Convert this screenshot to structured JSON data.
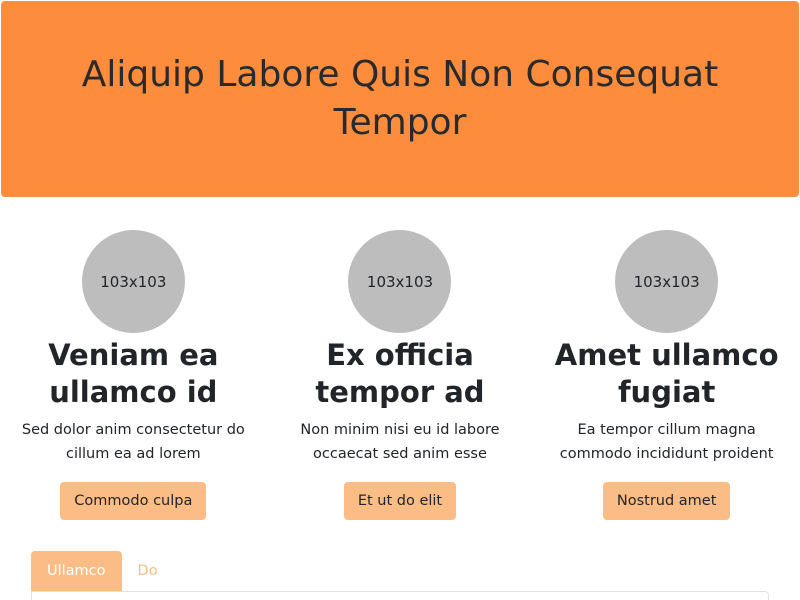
{
  "header": {
    "title": "Aliquip Labore Quis Non Consequat Tempor"
  },
  "cards": [
    {
      "image_label": "103x103",
      "title": "Veniam ea ullamco id",
      "text": "Sed dolor anim consectetur do cillum ea ad lorem",
      "button_label": "Commodo culpa"
    },
    {
      "image_label": "103x103",
      "title": "Ex officia tempor ad",
      "text": "Non minim nisi eu id labore occaecat sed anim esse",
      "button_label": "Et ut do elit"
    },
    {
      "image_label": "103x103",
      "title": "Amet ullamco fugiat",
      "text": "Ea tempor cillum magna commodo incididunt proident",
      "button_label": "Nostrud amet"
    }
  ],
  "tabs": [
    {
      "label": "Ullamco",
      "active": true
    },
    {
      "label": "Do",
      "active": false
    }
  ],
  "colors": {
    "hero_bg": "#fd8c3d",
    "button_bg": "#fbbd85",
    "avatar_bg": "#bdbdbd"
  }
}
